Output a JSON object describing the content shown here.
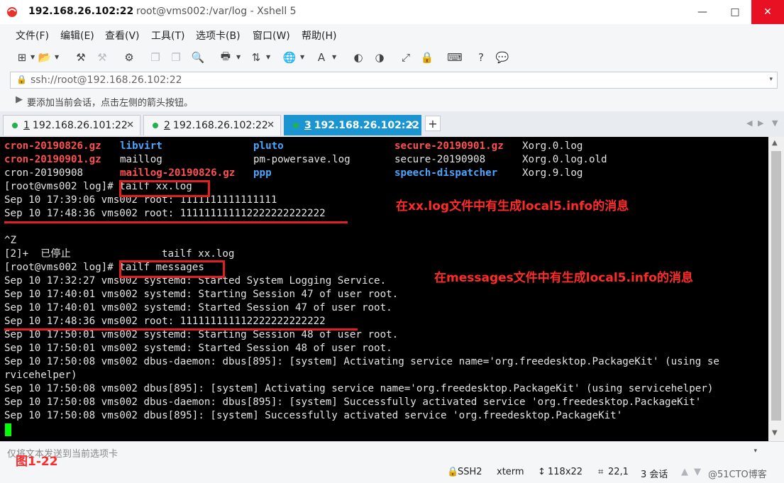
{
  "window": {
    "host_title": "192.168.26.102:22",
    "title_rest": "root@vms002:/var/log - Xshell 5",
    "minimize": "—",
    "maximize": "□",
    "close": "✕"
  },
  "menu": [
    "文件(F)",
    "编辑(E)",
    "查看(V)",
    "工具(T)",
    "选项卡(B)",
    "窗口(W)",
    "帮助(H)"
  ],
  "address": {
    "lock_icon": "🔒",
    "value": "ssh://root@192.168.26.102:22",
    "dropdown": "▾"
  },
  "session_hint": "要添加当前会话，点击左侧的箭头按钮。",
  "tabs": [
    {
      "num": "1",
      "label": "192.168.26.101:22",
      "close": "✕"
    },
    {
      "num": "2",
      "label": "192.168.26.102:22",
      "close": "✕"
    },
    {
      "num": "3",
      "label": "192.168.26.102:22",
      "close": "✕"
    }
  ],
  "tab_add": "+",
  "terminal": {
    "listing": [
      [
        {
          "t": "cron-20190826.gz",
          "c": "red"
        },
        {
          "t": "libvirt",
          "c": "blue"
        },
        {
          "t": "pluto",
          "c": "blue"
        },
        {
          "t": "secure-20190901.gz",
          "c": "red"
        },
        {
          "t": "Xorg.0.log",
          "c": "white"
        }
      ],
      [
        {
          "t": "cron-20190901.gz",
          "c": "red"
        },
        {
          "t": "maillog",
          "c": "white"
        },
        {
          "t": "pm-powersave.log",
          "c": "white"
        },
        {
          "t": "secure-20190908",
          "c": "white"
        },
        {
          "t": "Xorg.0.log.old",
          "c": "white"
        }
      ],
      [
        {
          "t": "cron-20190908",
          "c": "white"
        },
        {
          "t": "maillog-20190826.gz",
          "c": "red"
        },
        {
          "t": "ppp",
          "c": "blue"
        },
        {
          "t": "speech-dispatcher",
          "c": "blue"
        },
        {
          "t": "Xorg.9.log",
          "c": "white"
        }
      ]
    ],
    "lines": [
      "[root@vms002 log]# tailf xx.log",
      "Sep 10 17:39:06 vms002 root: 1111111111111111",
      "Sep 10 17:48:36 vms002 root: 111111111112222222222222",
      "",
      "^Z",
      "[2]+  已停止               tailf xx.log",
      "[root@vms002 log]# tailf messages",
      "Sep 10 17:32:27 vms002 systemd: Started System Logging Service.",
      "Sep 10 17:40:01 vms002 systemd: Starting Session 47 of user root.",
      "Sep 10 17:40:01 vms002 systemd: Started Session 47 of user root.",
      "Sep 10 17:48:36 vms002 root: 111111111112222222222222",
      "Sep 10 17:50:01 vms002 systemd: Starting Session 48 of user root.",
      "Sep 10 17:50:01 vms002 systemd: Started Session 48 of user root.",
      "Sep 10 17:50:08 vms002 dbus-daemon: dbus[895]: [system] Activating service name='org.freedesktop.PackageKit' (using se",
      "rvicehelper)",
      "Sep 10 17:50:08 vms002 dbus[895]: [system] Activating service name='org.freedesktop.PackageKit' (using servicehelper)",
      "Sep 10 17:50:08 vms002 dbus-daemon: dbus[895]: [system] Successfully activated service 'org.freedesktop.PackageKit'",
      "Sep 10 17:50:08 vms002 dbus[895]: [system] Successfully activated service 'org.freedesktop.PackageKit'"
    ]
  },
  "annotations": {
    "xxlog": "在xx.log文件中有生成local5.info的消息",
    "messages": "在messages文件中有生成local5.info的消息"
  },
  "input_placeholder": "仅将文本发送到当前选项卡",
  "figure_label": "图1-22",
  "status": {
    "protocol": "SSH2",
    "term": "xterm",
    "size": "118x22",
    "pos": "22,1",
    "sessions": "3 会话",
    "watermark": "@51CTO博客"
  },
  "colors": {
    "accent_tab": "#1b95d1",
    "annotation_red": "#ff2b2b",
    "terminal_bg": "#000000",
    "cursor": "#00ff00"
  }
}
